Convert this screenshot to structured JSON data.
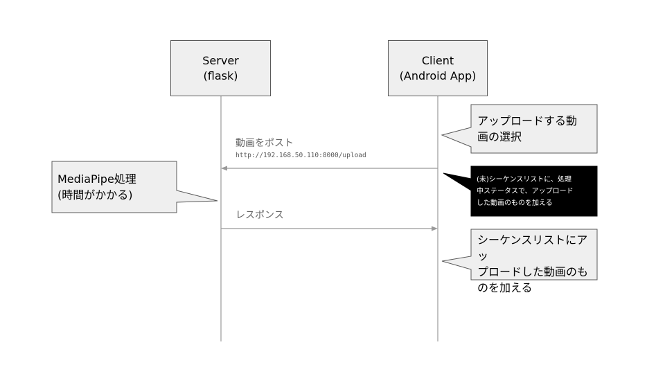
{
  "actors": [
    {
      "id": "server",
      "name": "Server",
      "detail": "(flask)"
    },
    {
      "id": "client",
      "name": "Client",
      "detail": "(Android App)"
    }
  ],
  "messages": [
    {
      "from": "client",
      "to": "server",
      "label": "動画をポスト",
      "url": "http://192.168.50.110:8000/upload"
    },
    {
      "from": "server",
      "to": "client",
      "label": "レスポンス"
    }
  ],
  "notes": {
    "client_select": [
      "アップロードする動",
      "画の選択"
    ],
    "server_process": [
      "MediaPipe処理",
      "(時間がかかる)"
    ],
    "client_pending": [
      "(未)シーケンスリストに、処理",
      "中ステータスで、アップロード",
      "した動画のものを加える"
    ],
    "client_done": [
      "シーケンスリストにアッ",
      "プロードした動画のも",
      "のを加える"
    ]
  },
  "colors": {
    "box_fill": "#efefef",
    "box_border": "#595959",
    "line": "#999999",
    "dark_note_fill": "#000000"
  }
}
